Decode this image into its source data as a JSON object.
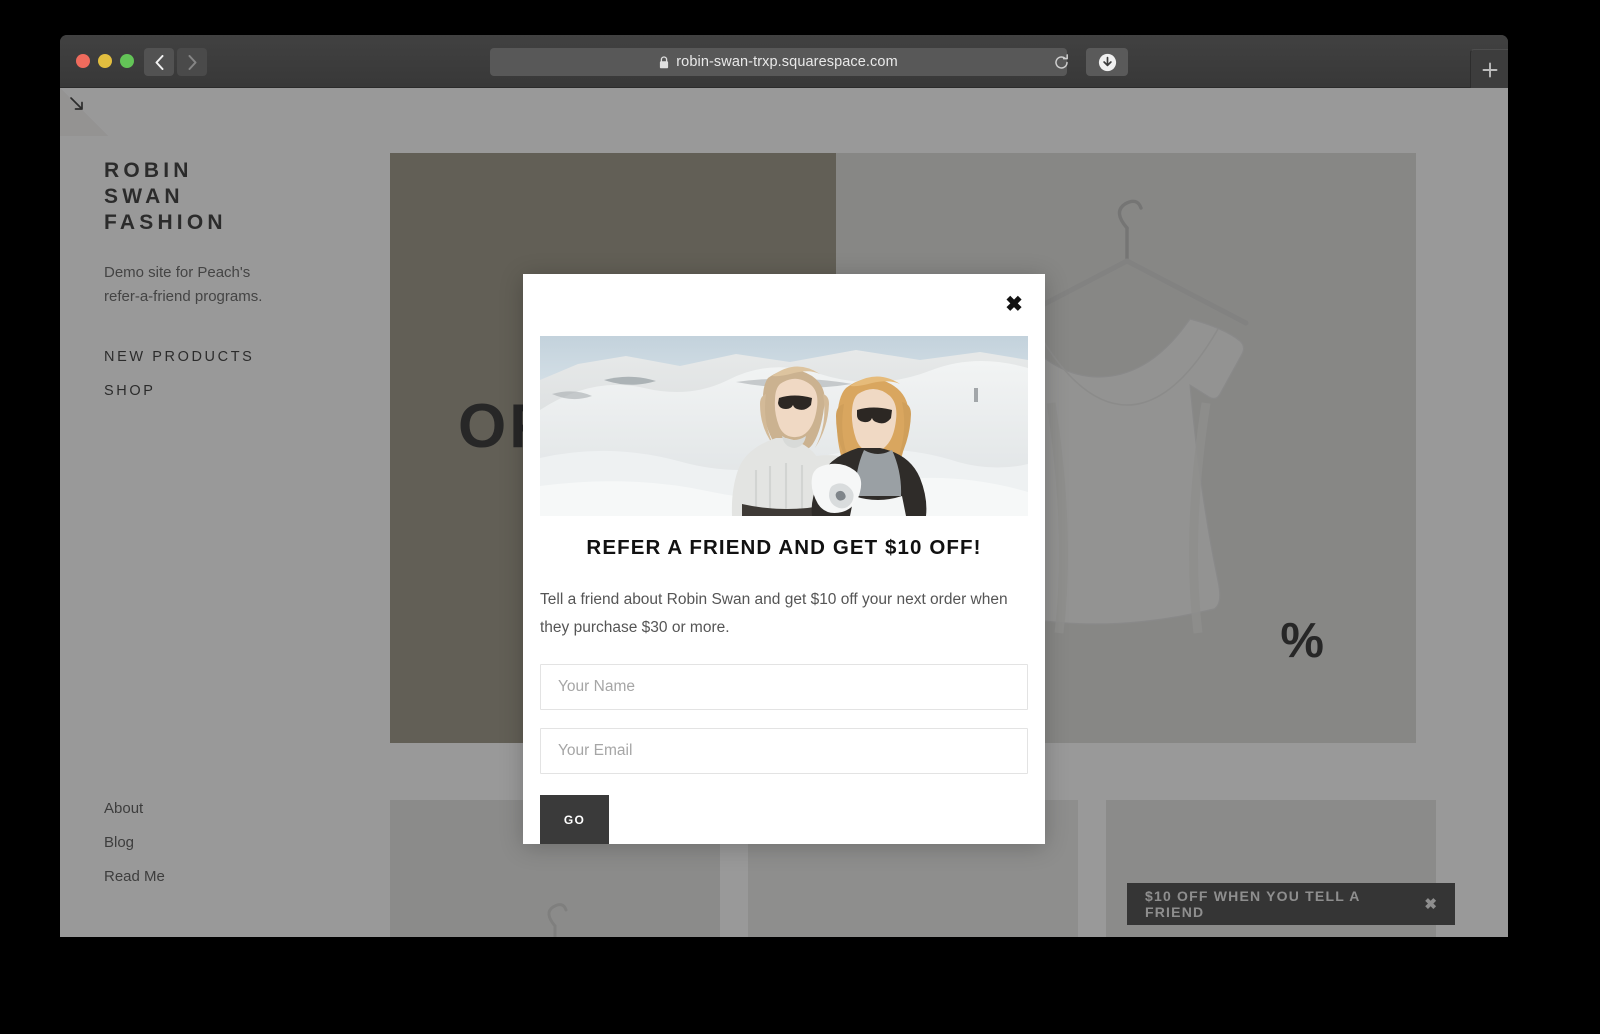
{
  "browser": {
    "url": "robin-swan-trxp.squarespace.com",
    "back_label": "Back",
    "forward_label": "Forward",
    "reload_label": "Reload",
    "download_label": "Downloads",
    "new_tab_label": "New Tab",
    "secure": true
  },
  "site": {
    "brand_line1": "ROBIN",
    "brand_line2": "SWAN",
    "brand_line3": "FASHION",
    "tagline": "Demo site for Peach's refer-a-friend programs.",
    "nav": [
      {
        "label": "NEW PRODUCTS"
      },
      {
        "label": "SHOP"
      }
    ],
    "footer": [
      {
        "label": "About"
      },
      {
        "label": "Blog"
      },
      {
        "label": "Read Me"
      }
    ],
    "hero_word": "OFF",
    "hero_percent": "%"
  },
  "promo_bar": {
    "text": "$10 OFF WHEN YOU TELL A FRIEND",
    "close_label": "✖"
  },
  "modal": {
    "close_label": "✖",
    "title": "REFER A FRIEND AND GET $10 OFF!",
    "description": "Tell a friend about Robin Swan and get $10 off your next order when they purchase $30 or more.",
    "name_placeholder": "Your Name",
    "name_value": "",
    "email_placeholder": "Your Email",
    "email_value": "",
    "submit_label": "GO",
    "photo_alt": "Two women in winter clothing standing on a snowy dune"
  },
  "colors": {
    "khaki_panel": "#8c8774",
    "promo_bar_bg": "#2e2e2e",
    "go_button_bg": "#3a3a3a",
    "text_dark": "#111111",
    "text_muted": "#555555"
  }
}
